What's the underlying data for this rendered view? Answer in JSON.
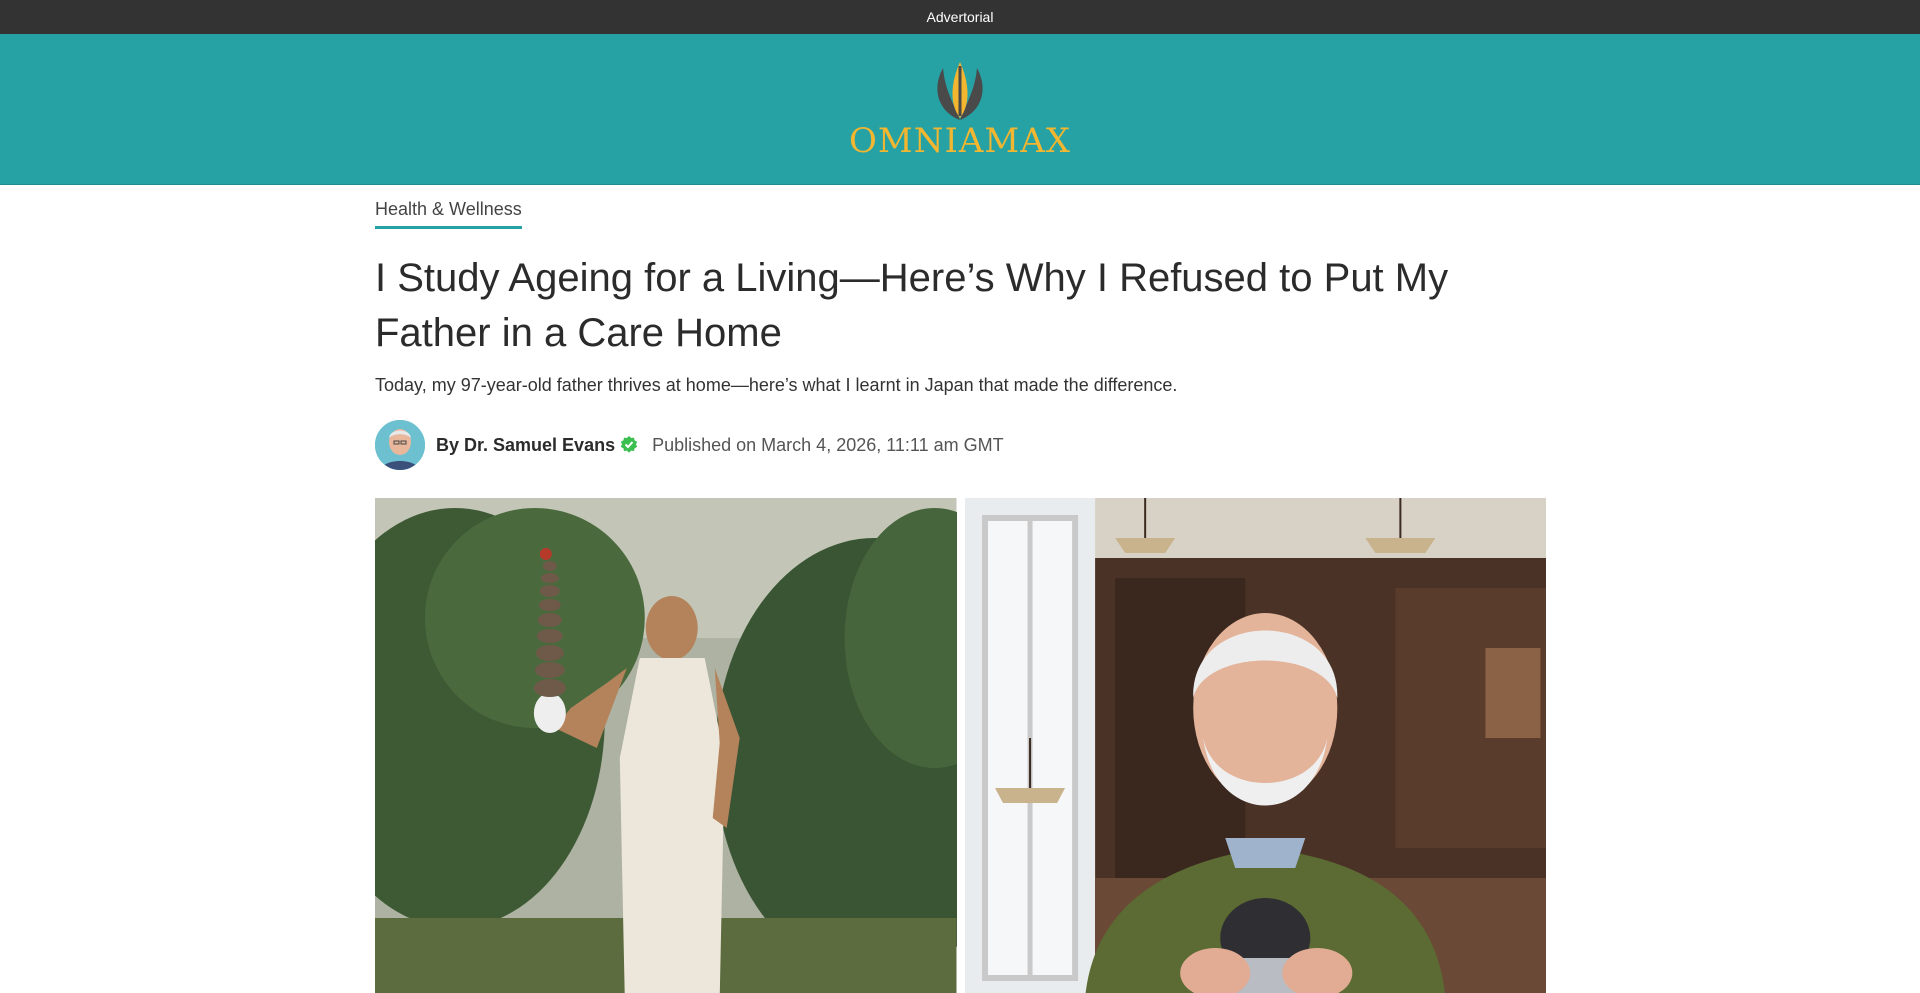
{
  "topbar": {
    "label": "Advertorial"
  },
  "brand": {
    "name": "OMNIAMAX",
    "primary": "#26a2a4",
    "accent": "#f2b630"
  },
  "article": {
    "category": "Health & Wellness",
    "title": "I Study Ageing for a Living—Here’s Why I Refused to Put My Father in a Care Home",
    "subtitle": "Today, my 97-year-old father thrives at home—here’s what I learnt in Japan that made the difference.",
    "author": "By Dr. Samuel Evans",
    "published": "Published on March 4, 2026, 11:11 am GMT"
  },
  "icons": {
    "verified": "verified-check-icon",
    "avatar": "author-avatar"
  }
}
